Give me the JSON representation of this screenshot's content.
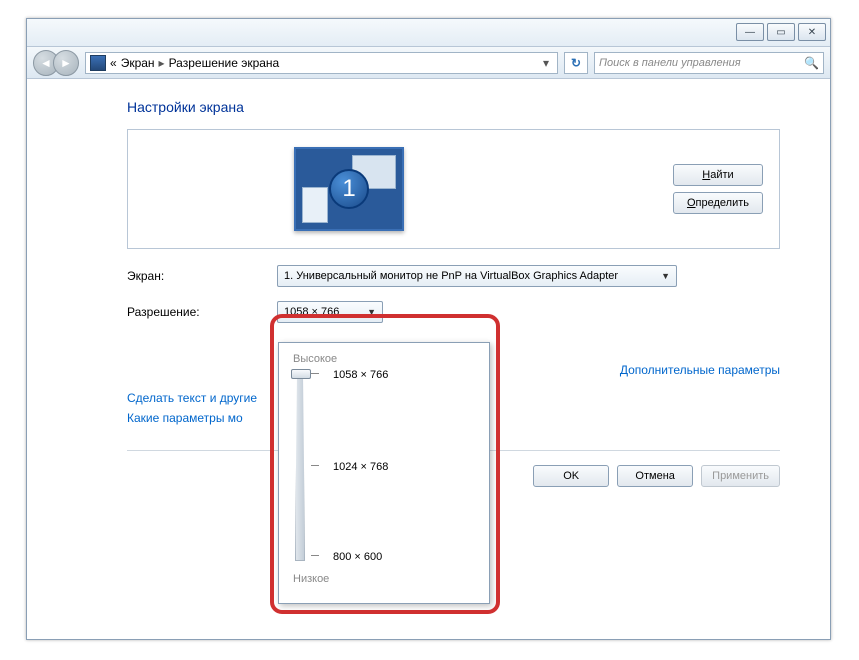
{
  "titlebar": {
    "min": "—",
    "max": "▭",
    "close": "✕"
  },
  "breadcrumb": {
    "back_prefix": "«",
    "item1": "Экран",
    "item2": "Разрешение экрана"
  },
  "search": {
    "placeholder": "Поиск в панели управления"
  },
  "page_title": "Настройки экрана",
  "monitor": {
    "number": "1"
  },
  "panel_buttons": {
    "find": "Найти",
    "find_u": "Н",
    "detect": "Определить",
    "detect_u": "О"
  },
  "rows": {
    "screen_label": "Экран:",
    "screen_value": "1. Универсальный монитор не PnP на VirtualBox Graphics Adapter",
    "resolution_label": "Разрешение:",
    "resolution_value": "1058 × 766"
  },
  "advanced_link": "Дополнительные параметры",
  "link1": "Сделать текст и другие",
  "link2": "Какие параметры мо",
  "footer": {
    "ok": "OK",
    "cancel": "Отмена",
    "apply": "Применить"
  },
  "res_popup": {
    "high": "Высокое",
    "low": "Низкое",
    "options": [
      {
        "label": "1058 × 766",
        "pos": 4
      },
      {
        "label": "1024 × 768",
        "pos": 96
      },
      {
        "label": "800 × 600",
        "pos": 186
      }
    ]
  }
}
